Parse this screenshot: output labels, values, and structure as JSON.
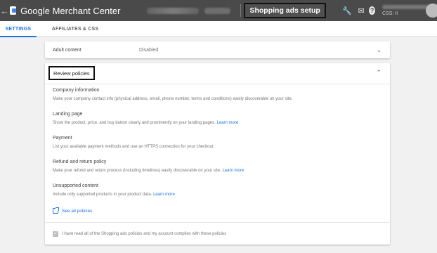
{
  "topbar": {
    "back_icon": "arrow-back-icon",
    "brand": "Google Merchant Center",
    "page_title": "Shopping ads setup",
    "account_id_label": "CSS: II",
    "icons": [
      "wrench-icon",
      "mail-icon",
      "help-icon"
    ]
  },
  "tabs": [
    {
      "label": "SETTINGS"
    },
    {
      "label": "AFFILIATES & CSS"
    }
  ],
  "adult_content": {
    "label": "Adult content",
    "value": "Disabled"
  },
  "review": {
    "title": "Review policies",
    "policies": [
      {
        "title": "Company information",
        "desc": "Make your company contact info (physical address, email, phone number, terms and conditions) easily discoverable on your site.",
        "link": ""
      },
      {
        "title": "Landing page",
        "desc": "Show the product, price, and buy button clearly and prominently on your landing pages.",
        "link": "Learn more"
      },
      {
        "title": "Payment",
        "desc": "List your available payment methods and use an HTTPS connection for your checkout.",
        "link": ""
      },
      {
        "title": "Refund and return policy",
        "desc": "Make your refund and return process (including timelines) easily discoverable on your site.",
        "link": "Learn more"
      },
      {
        "title": "Unsupported content",
        "desc": "Include only supported products in your product data.",
        "link": "Learn more"
      }
    ],
    "see_all": "See all policies",
    "confirm": "I have read all of the Shopping ads policies and my account complies with these policies"
  },
  "colors": {
    "topbar": "#4a4a4a",
    "accent": "#1a73e8",
    "background": "#f1f1f1"
  }
}
